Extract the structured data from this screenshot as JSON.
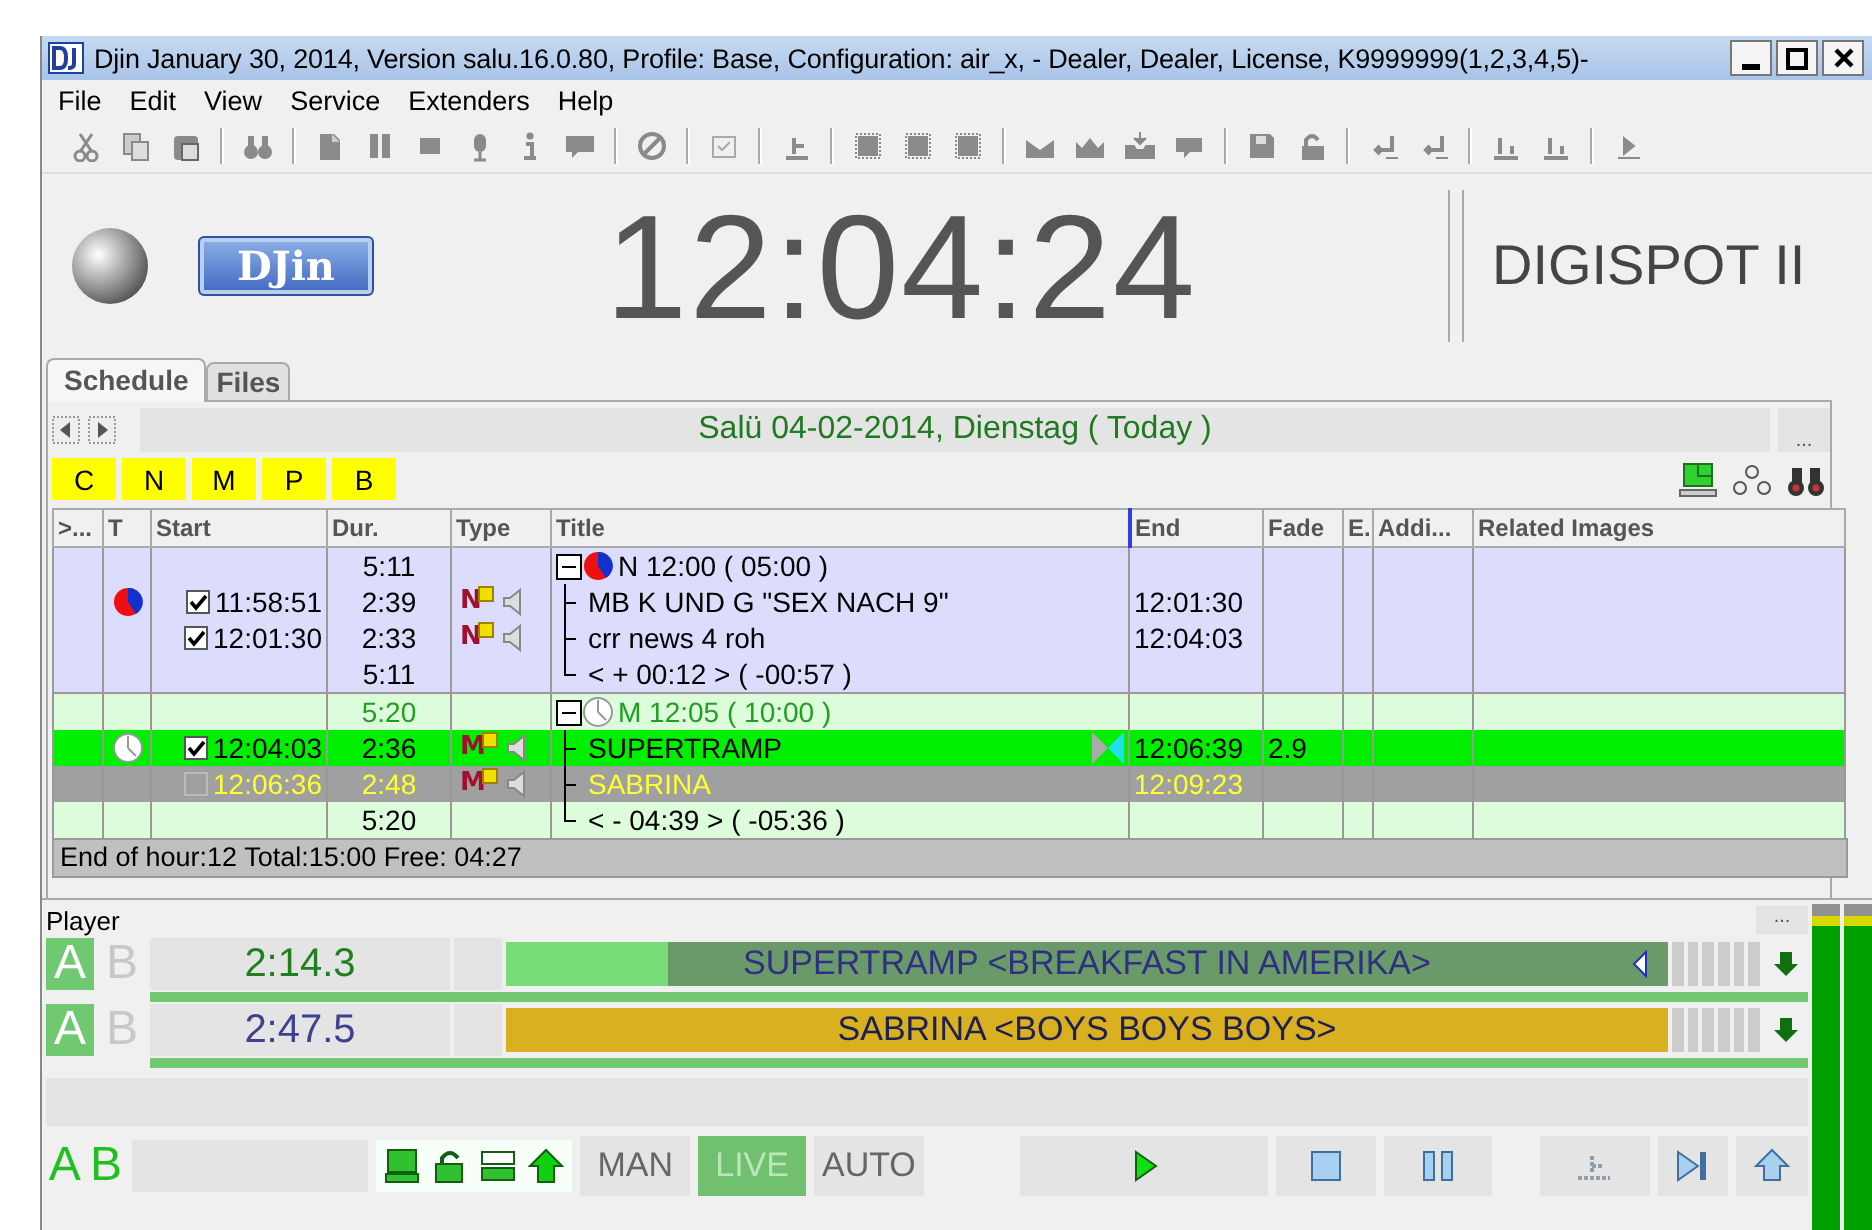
{
  "window": {
    "title": "Djin January 30, 2014, Version salu.16.0.80,  Profile: Base,  Configuration: air_x, - Dealer, Dealer,  License, K9999999(1,2,3,4,5)-"
  },
  "menu": [
    "File",
    "Edit",
    "View",
    "Service",
    "Extenders",
    "Help"
  ],
  "header": {
    "logo": "DJin",
    "clock": "12:04:24",
    "brand": "DIGISPOT II"
  },
  "tabs": [
    {
      "label": "Schedule",
      "selected": true
    },
    {
      "label": "Files",
      "selected": false
    }
  ],
  "schedule": {
    "date": "Salü 04-02-2014, Dienstag ( Today )",
    "more": "...",
    "categories": [
      "C",
      "N",
      "M",
      "P",
      "B"
    ],
    "columns": [
      ">...",
      "T",
      "Start",
      "Dur.",
      "Type",
      "Title",
      "End",
      "Fade",
      "E.",
      "Addi...",
      "Related Images"
    ],
    "blocks": [
      {
        "kind": "news",
        "color": "#dcdcfc",
        "expanded": true,
        "dur": "5:11",
        "title": "N 12:00 ( 05:00 )",
        "items": [
          {
            "marker": true,
            "checked": true,
            "start": "11:58:51",
            "dur": "2:39",
            "category": "N",
            "title": "MB K UND G \"SEX NACH 9\"",
            "end": "12:01:30",
            "playing": false,
            "next": false
          },
          {
            "marker": false,
            "checked": true,
            "start": "12:01:30",
            "dur": "2:33",
            "category": "N",
            "title": "crr news 4 roh",
            "end": "12:04:03",
            "playing": false,
            "next": false
          }
        ],
        "footer": {
          "dur": "5:11",
          "title": "< + 00:12 > ( -00:57 )"
        }
      },
      {
        "kind": "music",
        "color": "#dcfcdc",
        "expanded": true,
        "dur": "5:20",
        "title": "M 12:05 ( 10:00 )",
        "items": [
          {
            "marker": true,
            "checked": true,
            "start": "12:04:03",
            "dur": "2:36",
            "category": "M",
            "title": "SUPERTRAMP",
            "end": "12:06:39",
            "fade": "2.9",
            "playing": true,
            "next": false
          },
          {
            "marker": false,
            "checked": false,
            "start": "12:06:36",
            "dur": "2:48",
            "category": "M",
            "title": "SABRINA",
            "end": "12:09:23",
            "playing": false,
            "next": true
          }
        ],
        "footer": {
          "dur": "5:20",
          "title": "< - 04:39 > ( -05:36 )"
        }
      }
    ],
    "summary": "End of hour:12 Total:15:00 Free: 04:27"
  },
  "player": {
    "label": "Player",
    "more": "...",
    "decks": [
      {
        "channels": [
          {
            "label": "A",
            "selected": true
          },
          {
            "label": "B",
            "selected": false
          }
        ],
        "time": "2:14.3",
        "title": "SUPERTRAMP <BREAKFAST IN AMERIKA>",
        "playing": true,
        "level": 0.14
      },
      {
        "channels": [
          {
            "label": "A",
            "selected": true
          },
          {
            "label": "B",
            "selected": false
          }
        ],
        "time": "2:47.5",
        "title": "SABRINA <BOYS BOYS BOYS>",
        "playing": false,
        "level": 0
      }
    ],
    "outputs": [
      "A",
      "B"
    ],
    "modes": [
      {
        "label": "MAN",
        "selected": false
      },
      {
        "label": "LIVE",
        "selected": true
      },
      {
        "label": "AUTO",
        "selected": false
      }
    ],
    "meters": [
      {
        "level": 0.93
      },
      {
        "level": 0.93
      }
    ]
  }
}
